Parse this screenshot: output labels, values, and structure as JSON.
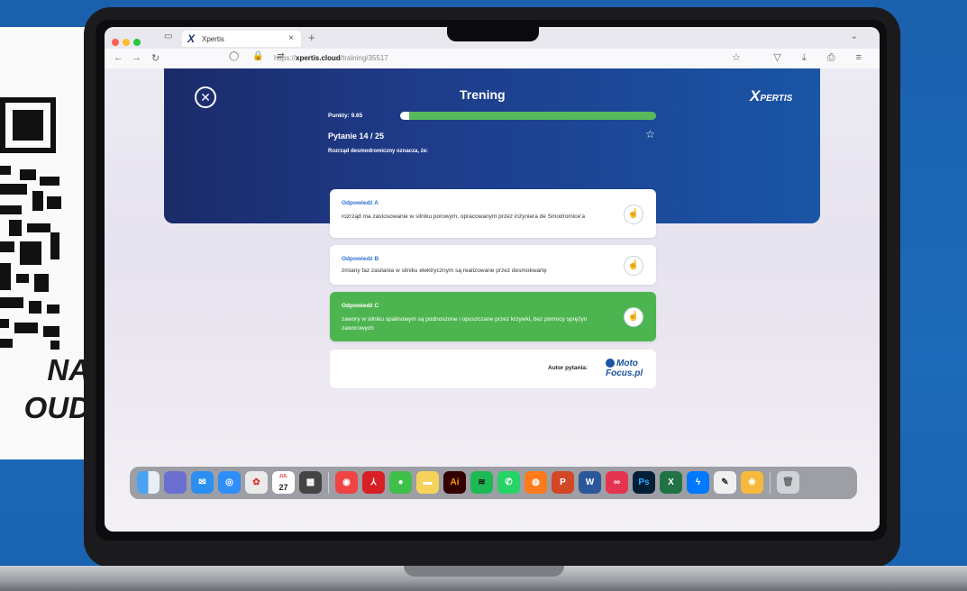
{
  "promo": {
    "line1": "NA",
    "line2": "OUD"
  },
  "browser": {
    "tab_logo": "X",
    "tab_title": "Xpertis",
    "tab_close": "×",
    "new_tab": "+",
    "tab_menu": "⌄",
    "back": "←",
    "forward": "→",
    "reload": "↻",
    "url_icons": "◯ 🔒 ⇄",
    "url_prefix": "https://",
    "url_host": "xpertis.cloud",
    "url_path": "/training/35517",
    "bookmark_star": "☆",
    "right_icons": "▽ ⤓ ⎙ ≡"
  },
  "page": {
    "close_glyph": "✕",
    "title": "Trening",
    "brand_x": "X",
    "brand_rest": "PERTIS",
    "points_label": "Punkty: 9.65",
    "question_number": "Pytanie 14 / 25",
    "star_glyph": "☆",
    "question_text": "Rozrząd desmodromiczny oznacza, że:",
    "answers": [
      {
        "label": "Odpowiedź A",
        "text": "rozrząd ma zastosowanie w silniku porowym, opracowanym przez inżyniera de Smodromice'a"
      },
      {
        "label": "Odpowiedź B",
        "text": "zmiany faz zasilania w silniku elektrycznym są realizowane przez desmokwartę"
      },
      {
        "label": "Odpowiedź C",
        "text": "zawory w silniku spalinowym są podnoszone i opuszczane przez krzywki, bez pomocy sprężyn zaworowych"
      }
    ],
    "answer_icon_glyph": "☝",
    "author_label": "Autor pytania:",
    "author_logo": "Moto Focus.pl"
  },
  "dock": {
    "calendar_day": "27",
    "calendar_month": "JUL"
  },
  "colors": {
    "background": "#1b66b5",
    "banner_start": "#1b2b6a",
    "banner_end": "#1a55a6",
    "correct": "#4db54f",
    "answer_label": "#2a6fd0"
  }
}
